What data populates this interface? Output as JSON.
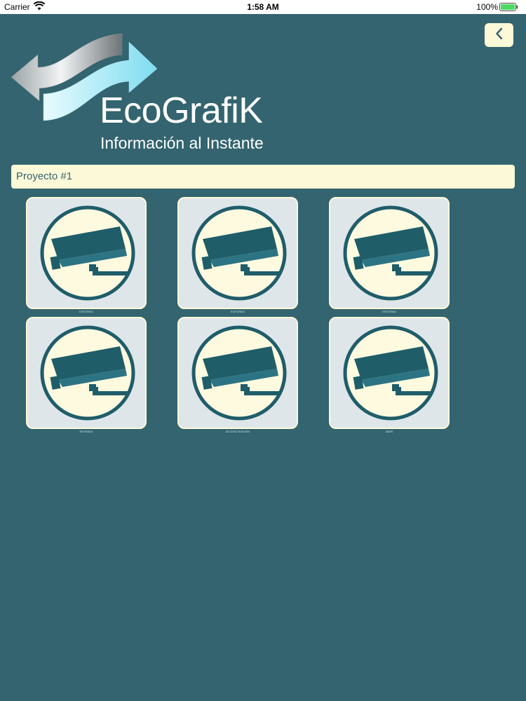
{
  "status_bar": {
    "carrier": "Carrier",
    "time": "1:58 AM",
    "battery": "100%"
  },
  "header": {
    "brand_name": "EcoGrafiK",
    "tagline": "Información al Instante",
    "back_icon": "chevron-left-icon"
  },
  "project": {
    "name": "Proyecto #1"
  },
  "cameras": [
    {
      "label": "ENTORNO",
      "icon": "security-camera-icon"
    },
    {
      "label": "ENTORNO",
      "icon": "security-camera-icon"
    },
    {
      "label": "ENTORNO",
      "icon": "security-camera-icon"
    },
    {
      "label": "ENTRADA",
      "icon": "security-camera-icon"
    },
    {
      "label": "ACCESO BASURA",
      "icon": "security-camera-icon"
    },
    {
      "label": "NAVE",
      "icon": "security-camera-icon"
    }
  ],
  "colors": {
    "background": "#33646f",
    "panel": "#fcf9d8",
    "card": "#dfe6ea",
    "icon_dark": "#1f5d69",
    "icon_light": "#fdfae0"
  }
}
